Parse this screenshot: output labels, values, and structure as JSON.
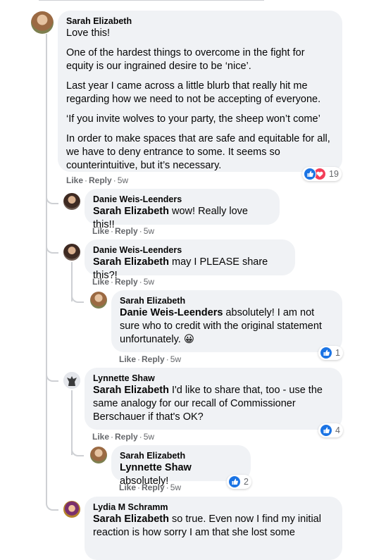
{
  "comments": [
    {
      "author": "Sarah Elizabeth",
      "paragraphs": [
        "Love this!",
        "One of the hardest things to overcome in the fight for equity is our ingrained desire to be ‘nice’.",
        "Last year I came across a little blurb that really hit me regarding how we need to not be accepting of everyone.",
        "‘If you invite wolves to your party, the sheep won’t come’",
        "In order to make spaces that are safe and equitable for all, we have to deny entrance to some. It seems so counterintuitive, but it’s necessary."
      ],
      "like_label": "Like",
      "reply_label": "Reply",
      "time": "5w",
      "reaction_count": "19"
    },
    {
      "author": "Danie Weis-Leenders",
      "mention": "Sarah Elizabeth",
      "text": " wow! Really love this!!",
      "like_label": "Like",
      "reply_label": "Reply",
      "time": "5w"
    },
    {
      "author": "Danie Weis-Leenders",
      "mention": "Sarah Elizabeth",
      "text": " may I PLEASE share this?!",
      "like_label": "Like",
      "reply_label": "Reply",
      "time": "5w"
    },
    {
      "author": "Sarah Elizabeth",
      "mention": "Danie Weis-Leenders",
      "text": " absolutely! I am not sure who to credit with the original statement unfortunately. 😀",
      "like_label": "Like",
      "reply_label": "Reply",
      "time": "5w",
      "reaction_count": "1"
    },
    {
      "author": "Lynnette Shaw",
      "mention": "Sarah Elizabeth",
      "text": " I'd like to share that, too - use the same analogy for our recall of Commissioner Berschauer if that's OK?",
      "like_label": "Like",
      "reply_label": "Reply",
      "time": "5w",
      "reaction_count": "4"
    },
    {
      "author": "Sarah Elizabeth",
      "mention": "Lynnette Shaw",
      "text": " absolutely!",
      "like_label": "Like",
      "reply_label": "Reply",
      "time": "5w",
      "reaction_count": "2"
    },
    {
      "author": "Lydia M Schramm",
      "mention": "Sarah Elizabeth",
      "text": " so true. Even now I find my initial reaction is how sorry I am that she lost some"
    }
  ],
  "separator": "·",
  "colors": {
    "bubble": "#f0f2f5",
    "meta": "#65676b",
    "like_blue": "#1b74e4",
    "love_red": "#f33e58",
    "thread_line": "#ced0d4"
  },
  "icons": {
    "like": "thumbs-up-icon",
    "love": "heart-icon"
  }
}
